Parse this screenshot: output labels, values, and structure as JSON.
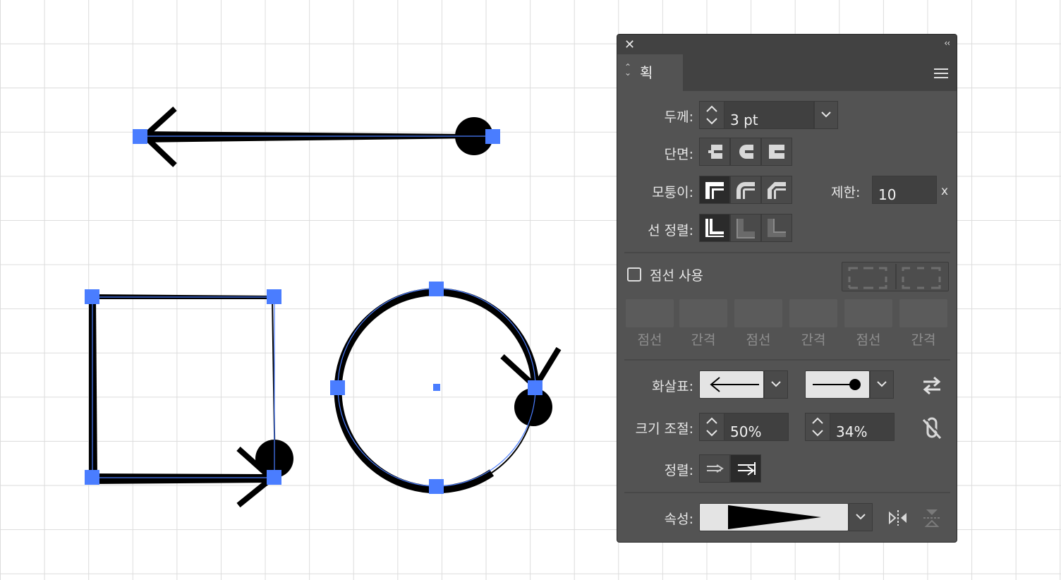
{
  "panel": {
    "close_icon": "close-icon",
    "collapse_icon": "collapse-icon",
    "tab_title": "획",
    "menu_icon": "hamburger-menu-icon",
    "weight": {
      "label": "두께:",
      "value": "3 pt"
    },
    "cap": {
      "label": "단면:"
    },
    "corner": {
      "label": "모퉁이:",
      "limit_label": "제한:",
      "limit_value": "10",
      "limit_unit": "x"
    },
    "align_stroke": {
      "label": "선 정렬:"
    },
    "dashed": {
      "label": "점선 사용",
      "checked": false,
      "fields": [
        "점선",
        "간격",
        "점선",
        "간격",
        "점선",
        "간격"
      ]
    },
    "arrowheads": {
      "label": "화살표:",
      "start": "arrow-start",
      "end": "dot-end"
    },
    "scale": {
      "label": "크기 조절:",
      "start_value": "50%",
      "end_value": "34%"
    },
    "align": {
      "label": "정렬:"
    },
    "profile": {
      "label": "속성:"
    }
  },
  "colors": {
    "selection": "#4a7dff",
    "panel_bg": "#535353",
    "panel_dark": "#424242"
  }
}
